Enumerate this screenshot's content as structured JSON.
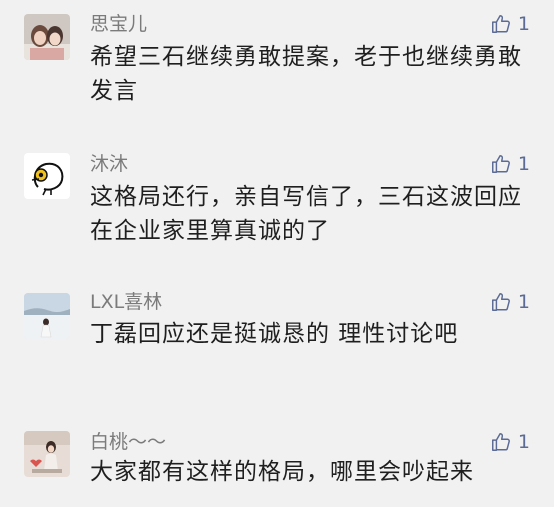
{
  "comments": [
    {
      "name": "思宝儿",
      "text": "希望三石继续勇敢提案，老于也继续勇敢发言",
      "likes": "1",
      "avatar_icon": "avatar-photo-icon"
    },
    {
      "name": "沐沐",
      "text": "这格局还行，亲自写信了，三石这波回应在企业家里算真诚的了",
      "likes": "1",
      "avatar_icon": "avatar-chick-icon"
    },
    {
      "name": "LXL喜林",
      "text": "丁磊回应还是挺诚恳的 理性讨论吧",
      "likes": "1",
      "avatar_icon": "avatar-photo-icon"
    },
    {
      "name": "白桃～～",
      "text": "大家都有这样的格局，哪里会吵起来",
      "likes": "1",
      "avatar_icon": "avatar-photo-icon"
    }
  ],
  "colors": {
    "background": "#f1f1f1",
    "name": "#7b7b7b",
    "text": "#1f1f1f",
    "like": "#5b6b95"
  }
}
